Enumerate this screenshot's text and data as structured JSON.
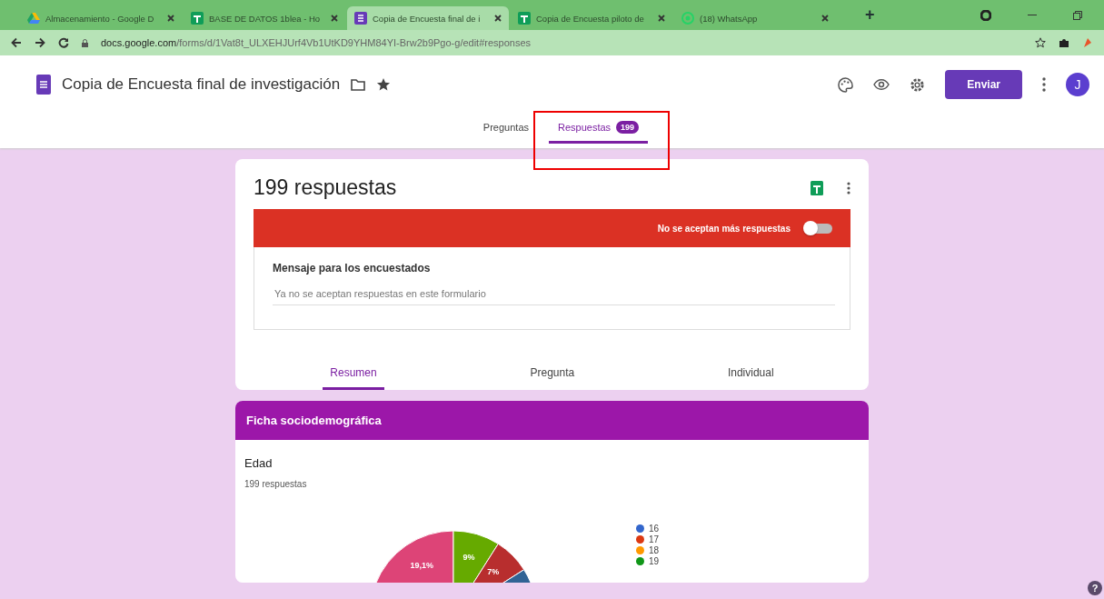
{
  "browser": {
    "tabs": [
      {
        "title": "Almacenamiento - Google D",
        "kind": "drive",
        "selected": false
      },
      {
        "title": "BASE DE DATOS 1blea - Ho",
        "kind": "sheet",
        "selected": false
      },
      {
        "title": "Copia de Encuesta final de i",
        "kind": "form",
        "selected": true
      },
      {
        "title": "Copia de Encuesta piloto de",
        "kind": "sheet",
        "selected": false
      },
      {
        "title": "(18) WhatsApp",
        "kind": "chat",
        "selected": false
      }
    ],
    "new_tab": "+",
    "url_host": "docs.google.com",
    "url_path": "/forms/d/1Vat8t_ULXEHJUrf4Vb1UtKD9YHM84YI-Brw2b9Pgo-g/edit#responses"
  },
  "form": {
    "title": "Copia de Encuesta final de investigación",
    "send_button": "Enviar",
    "avatar": "J",
    "nav_tabs": [
      {
        "label": "Preguntas",
        "selected": false
      },
      {
        "label": "Respuestas",
        "badge": "199",
        "selected": true
      }
    ]
  },
  "summary": {
    "heading": "199 respuestas",
    "accepting_label": "No se aceptan más respuestas",
    "accepting": false,
    "message_label": "Mensaje para los encuestados",
    "message_value": "Ya no se aceptan respuestas en este formulario",
    "view_tabs": [
      {
        "label": "Resumen",
        "selected": true
      },
      {
        "label": "Pregunta",
        "selected": false
      },
      {
        "label": "Individual",
        "selected": false
      }
    ]
  },
  "section": {
    "title": "Ficha sociodemográfica",
    "question": "Edad",
    "count": "199 respuestas",
    "slice_labels": [
      "19,1%",
      "9%",
      "7%"
    ],
    "legend": [
      {
        "label": "16",
        "color": "#3366cc"
      },
      {
        "label": "17",
        "color": "#dc3912"
      },
      {
        "label": "18",
        "color": "#ff9900"
      },
      {
        "label": "19",
        "color": "#109618"
      }
    ]
  },
  "help": "?"
}
